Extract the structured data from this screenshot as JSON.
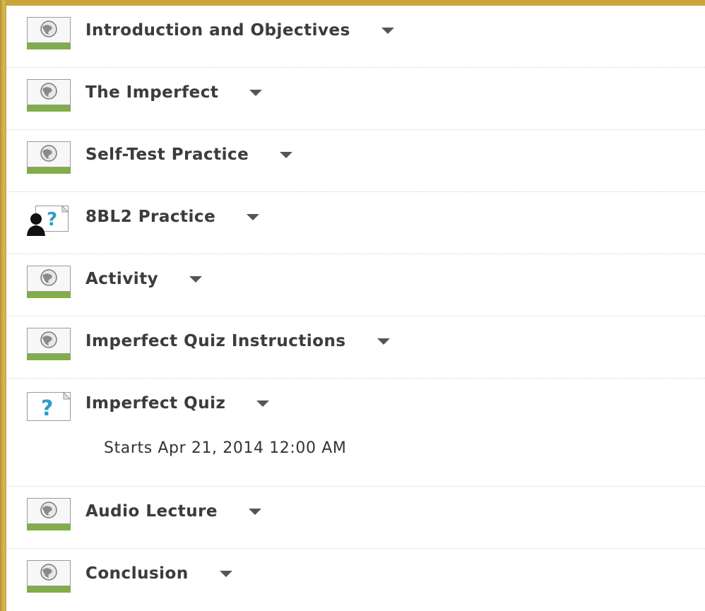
{
  "colors": {
    "frame": "#c9a43b",
    "icon_bar": "#7fae4a",
    "title_text": "#3c3c3c",
    "quiz_mark": "#2e9cc9"
  },
  "items": [
    {
      "label": "Introduction and Objectives",
      "icon": "web-page-icon"
    },
    {
      "label": "The Imperfect",
      "icon": "web-page-icon"
    },
    {
      "label": "Self-Test Practice",
      "icon": "web-page-icon"
    },
    {
      "label": "8BL2 Practice",
      "icon": "user-quiz-icon"
    },
    {
      "label": "Activity",
      "icon": "web-page-icon"
    },
    {
      "label": "Imperfect Quiz Instructions",
      "icon": "web-page-icon"
    },
    {
      "label": "Imperfect Quiz",
      "icon": "quiz-icon",
      "subtext": "Starts Apr 21, 2014 12:00 AM"
    },
    {
      "label": "Audio Lecture",
      "icon": "web-page-icon"
    },
    {
      "label": "Conclusion",
      "icon": "web-page-icon"
    }
  ]
}
